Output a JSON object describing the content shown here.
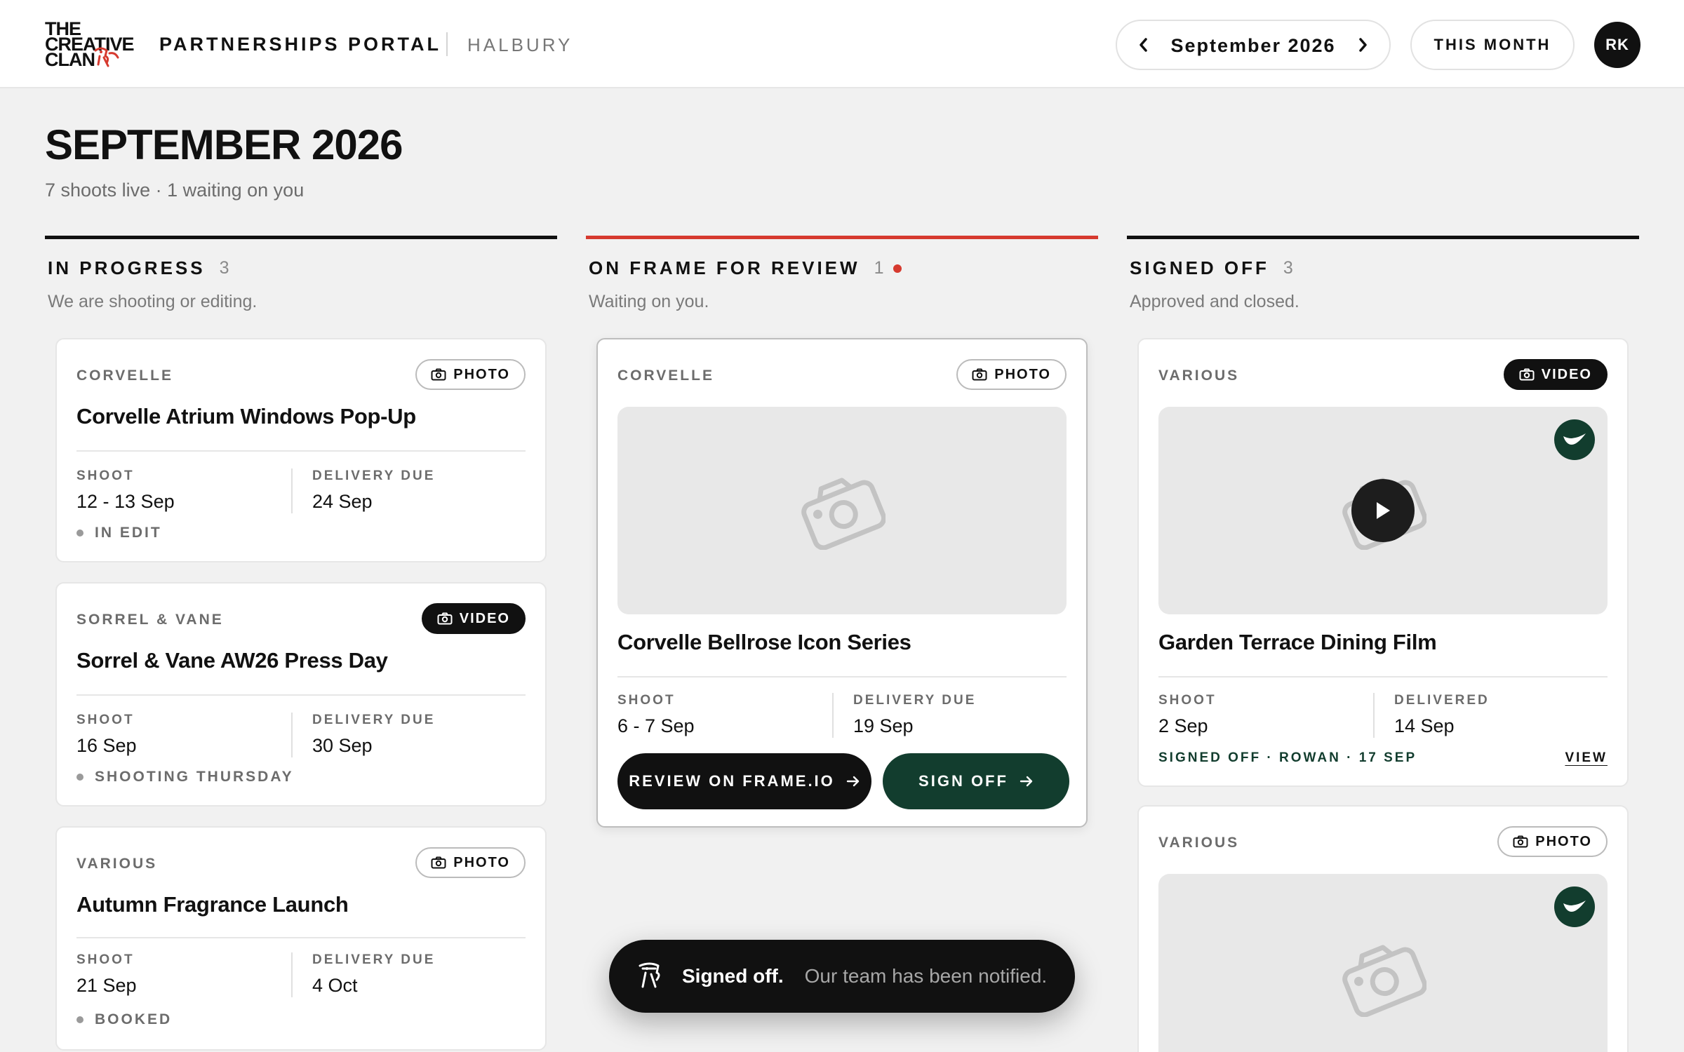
{
  "header": {
    "logo_lines": [
      "THE",
      "CREATIVE",
      "CLAN"
    ],
    "portal_name": "PARTNERSHIPS PORTAL",
    "org_name": "HALBURY",
    "month_label": "September 2026",
    "this_month_label": "THIS MONTH",
    "avatar_initials": "RK"
  },
  "page": {
    "title": "SEPTEMBER 2026",
    "subtitle": "7 shoots live · 1 waiting on you"
  },
  "columns": [
    {
      "title": "IN PROGRESS",
      "count": "3",
      "description": "We are shooting or editing.",
      "cards": [
        {
          "client": "CORVELLE",
          "badge": "PHOTO",
          "title": "Corvelle Atrium Windows Pop-Up",
          "meta1_label": "SHOOT",
          "meta1_value": "12 - 13 Sep",
          "meta2_label": "DELIVERY DUE",
          "meta2_value": "24 Sep",
          "status": "IN EDIT"
        },
        {
          "client": "SORREL & VANE",
          "badge": "VIDEO",
          "title": "Sorrel & Vane AW26 Press Day",
          "meta1_label": "SHOOT",
          "meta1_value": "16 Sep",
          "meta2_label": "DELIVERY DUE",
          "meta2_value": "30 Sep",
          "status": "SHOOTING THURSDAY"
        },
        {
          "client": "VARIOUS",
          "badge": "PHOTO",
          "title": "Autumn Fragrance Launch",
          "meta1_label": "SHOOT",
          "meta1_value": "21 Sep",
          "meta2_label": "DELIVERY DUE",
          "meta2_value": "4 Oct",
          "status": "BOOKED"
        }
      ]
    },
    {
      "title": "ON FRAME FOR REVIEW",
      "count": "1",
      "description": "Waiting on you.",
      "cards": [
        {
          "client": "CORVELLE",
          "badge": "PHOTO",
          "title": "Corvelle Bellrose Icon Series",
          "meta1_label": "SHOOT",
          "meta1_value": "6 - 7 Sep",
          "meta2_label": "DELIVERY DUE",
          "meta2_value": "19 Sep",
          "review_button": "REVIEW ON FRAME.IO",
          "signoff_button": "SIGN OFF"
        }
      ]
    },
    {
      "title": "SIGNED OFF",
      "count": "3",
      "description": "Approved and closed.",
      "cards": [
        {
          "client": "VARIOUS",
          "badge": "VIDEO",
          "title": "Garden Terrace Dining Film",
          "meta1_label": "SHOOT",
          "meta1_value": "2 Sep",
          "meta2_label": "DELIVERED",
          "meta2_value": "14 Sep",
          "signed_line": "SIGNED OFF · ROWAN · 17 SEP",
          "view_link": "VIEW"
        },
        {
          "client": "VARIOUS",
          "badge": "PHOTO"
        }
      ]
    }
  ],
  "toast": {
    "title": "Signed off.",
    "message": "Our team has been notified."
  },
  "colors": {
    "accent_red": "#d63a2f",
    "signed_green": "#123d2e",
    "ink": "#111111",
    "page_bg": "#f1f1f1"
  },
  "icons": [
    "chevron-left-icon",
    "chevron-right-icon",
    "camera-icon",
    "video-camera-icon",
    "arrow-right-icon",
    "check-icon",
    "play-icon",
    "mascot-icon"
  ]
}
